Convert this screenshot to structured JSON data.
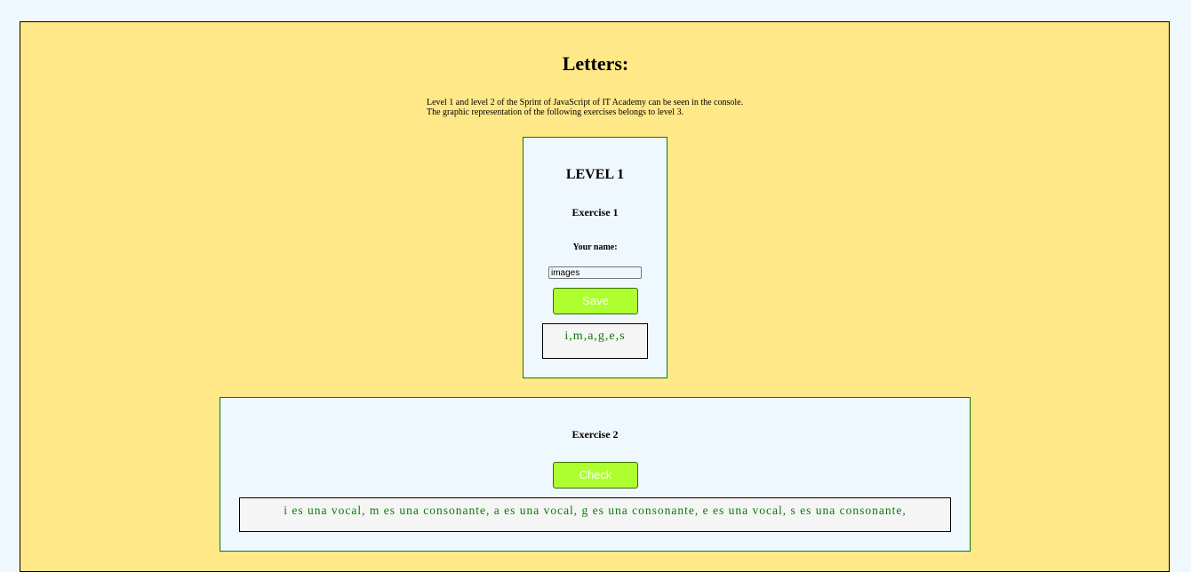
{
  "page": {
    "title": "Letters:",
    "intro_line1": "Level 1 and level 2 of the Sprint of JavaScript of IT Academy can be seen in the console.",
    "intro_line2": "The graphic representation of the following exercises belongs to level 3."
  },
  "level1": {
    "heading": "LEVEL 1",
    "exercise1": {
      "title": "Exercise 1",
      "name_label": "Your name:",
      "name_value": "images",
      "save_label": "Save",
      "output": "i,m,a,g,e,s"
    },
    "exercise2": {
      "title": "Exercise 2",
      "check_label": "Check",
      "output": "i es una vocal, m es una consonante, a es una vocal, g es una consonante, e es una vocal, s es una consonante,"
    }
  },
  "colors": {
    "page_background": "#f0f8ff",
    "panel_background": "#ffe888",
    "button_background": "#adff2f",
    "output_text": "#0a7a0a"
  }
}
